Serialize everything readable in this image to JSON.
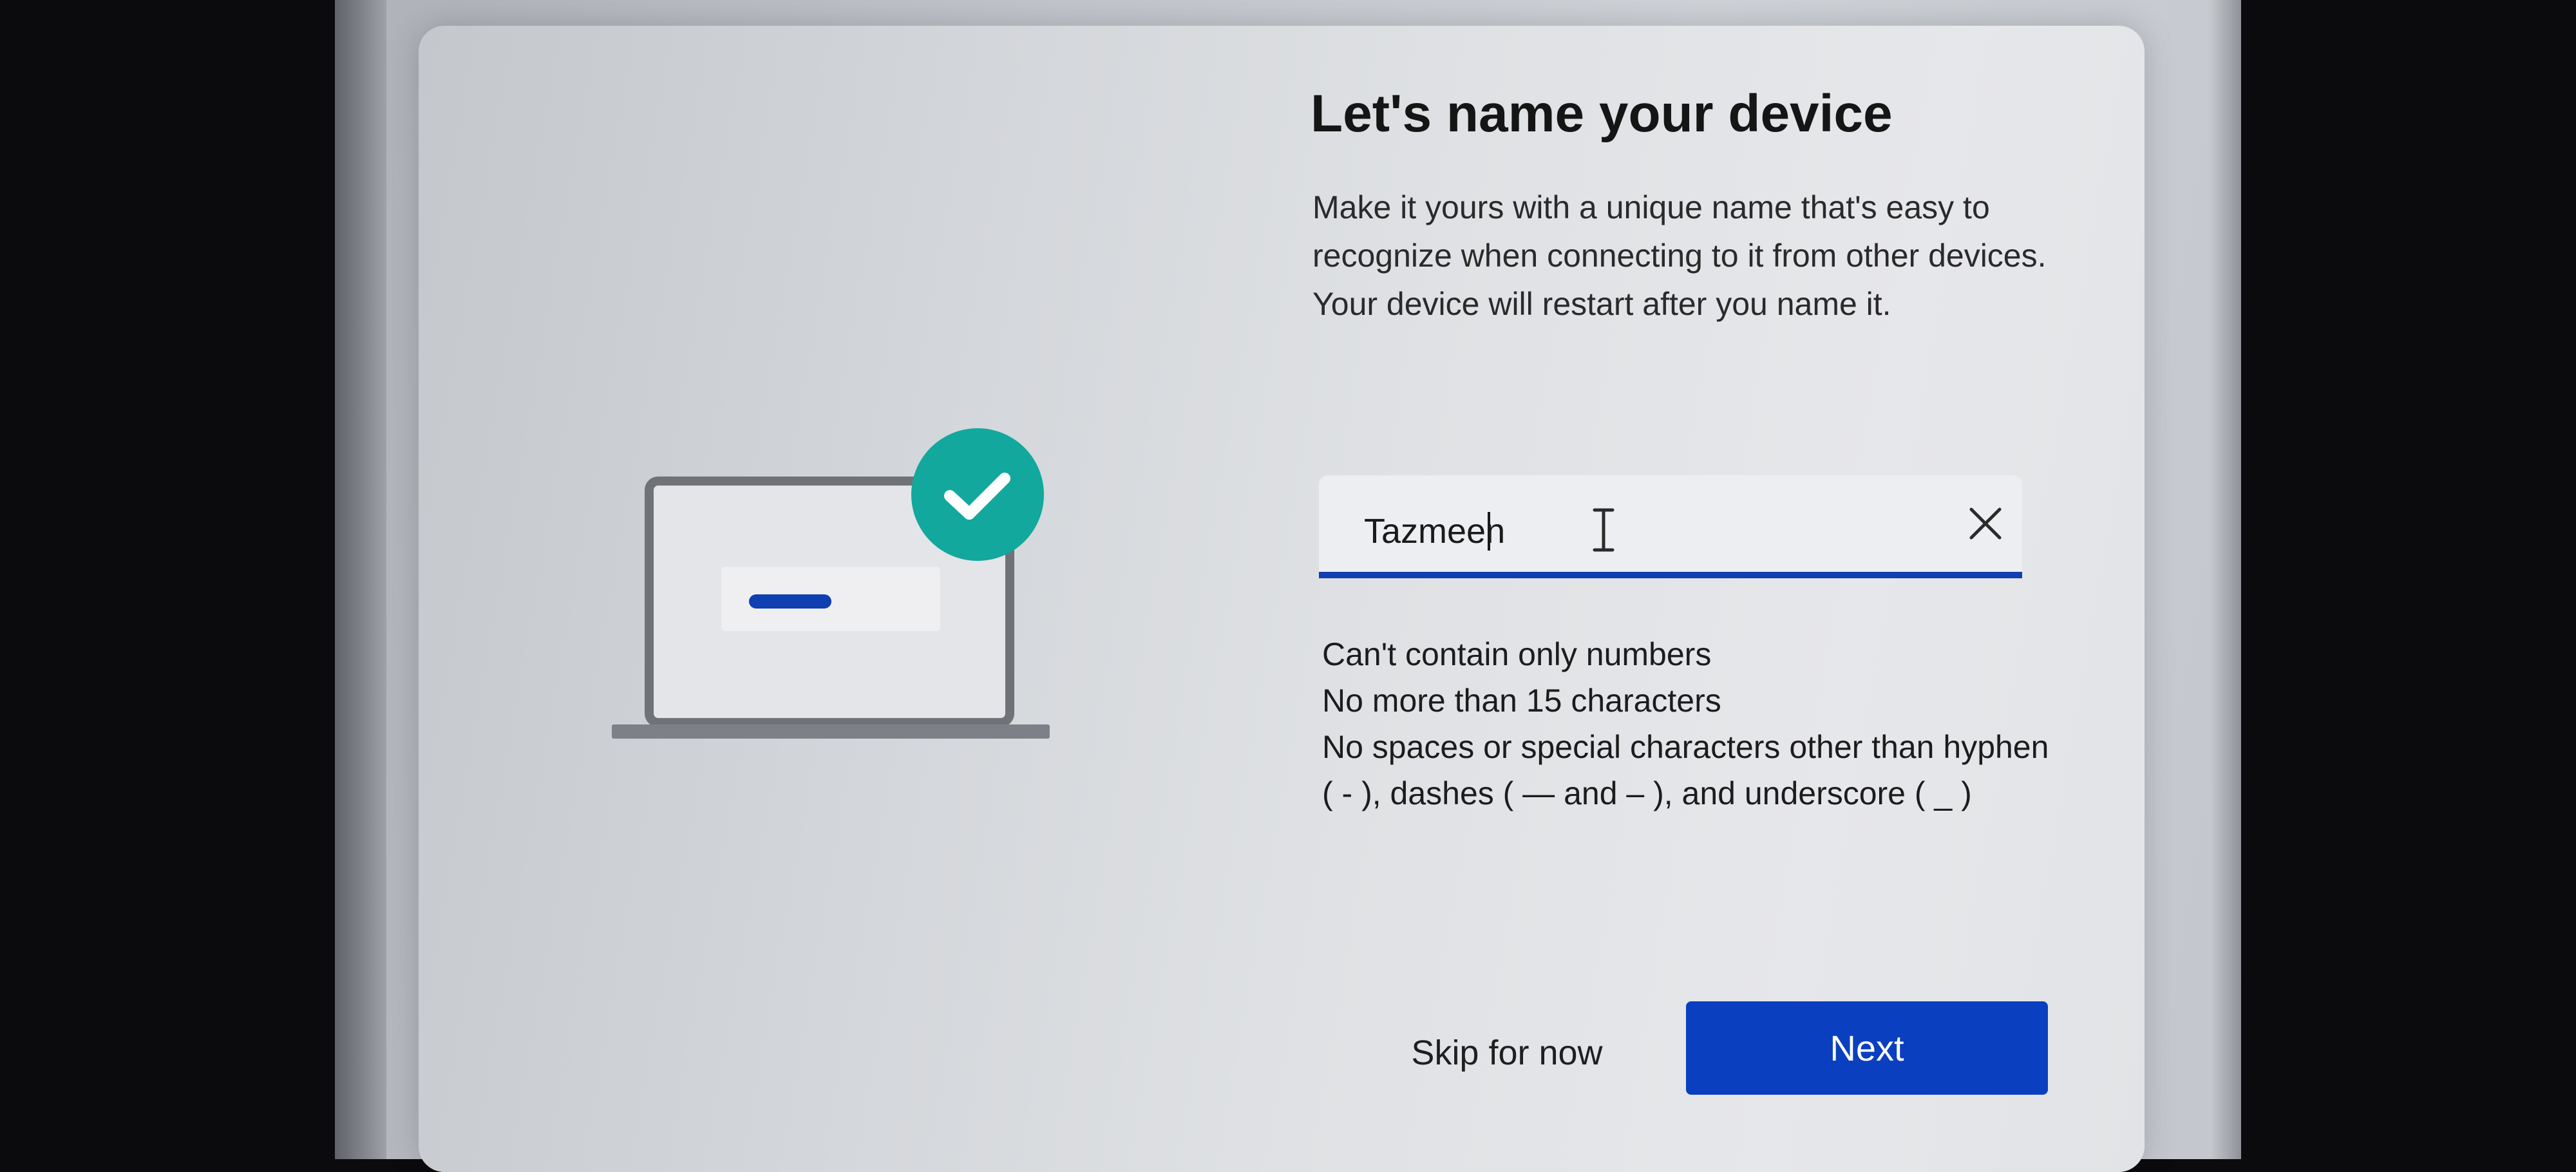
{
  "dialog": {
    "title": "Let's name your device",
    "description": "Make it yours with a unique name that's easy to recognize when connecting to it from other devices. Your device will restart after you name it."
  },
  "name_input": {
    "value": "Tazmeen",
    "clear_icon": "close-icon",
    "cursor_icon": "text-cursor-icon"
  },
  "rules": [
    "Can't contain only numbers",
    "No more than 15 characters",
    "No spaces or special characters other than hyphen ( - ), dashes ( — and – ), and underscore ( _ )"
  ],
  "buttons": {
    "skip_label": "Skip for now",
    "next_label": "Next"
  },
  "illustration": {
    "icons": [
      "laptop-icon",
      "checkmark-icon"
    ],
    "accent_color": "#12a89d"
  },
  "colors": {
    "primary": "#0a3fc0",
    "field_underline": "#0f3fb0"
  }
}
